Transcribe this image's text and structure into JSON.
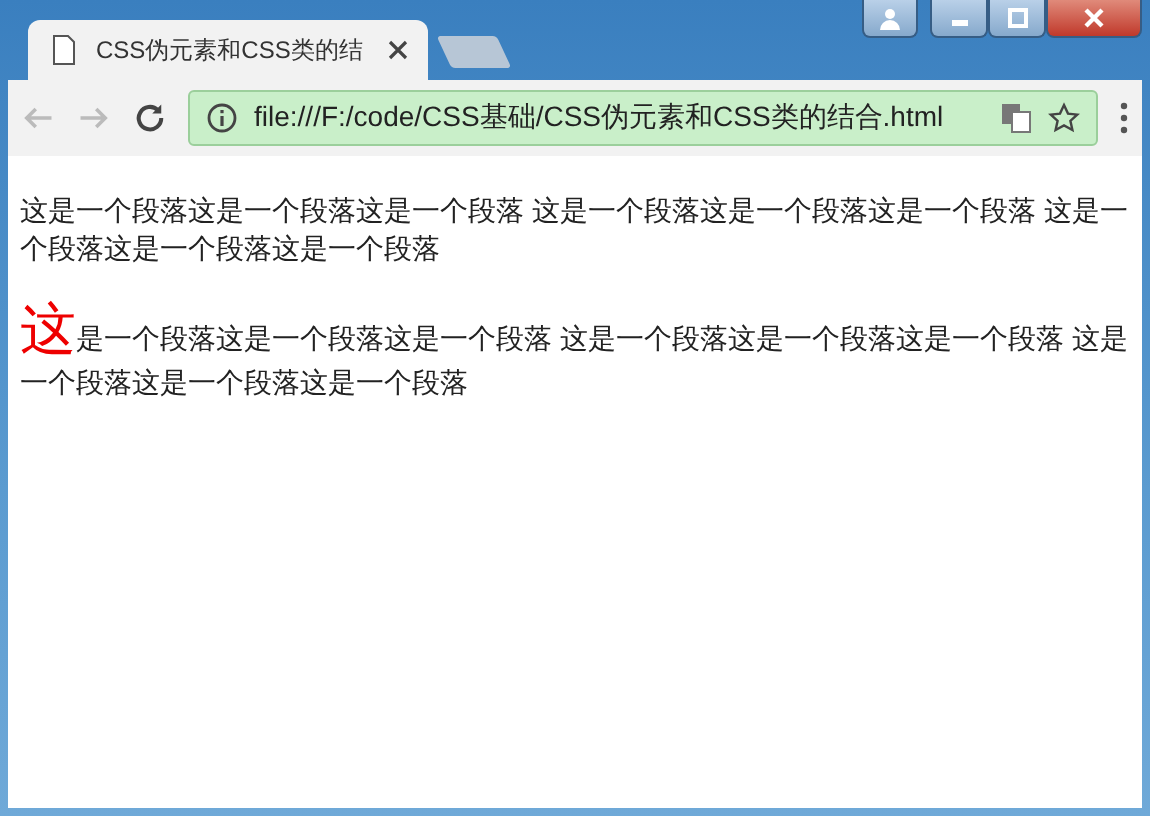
{
  "tab": {
    "title": "CSS伪元素和CSS类的结",
    "selected": true
  },
  "address_bar": {
    "url": "file:///F:/code/CSS基础/CSS伪元素和CSS类的结合.html"
  },
  "paragraphs": [
    {
      "text": "这是一个段落这是一个段落这是一个段落 这是一个段落这是一个段落这是一个段落 这是一个段落这是一个段落这是一个段落"
    },
    {
      "first_letter": "这",
      "text": "是一个段落这是一个段落这是一个段落 这是一个段落这是一个段落这是一个段落 这是一个段落这是一个段落这是一个段落"
    }
  ]
}
